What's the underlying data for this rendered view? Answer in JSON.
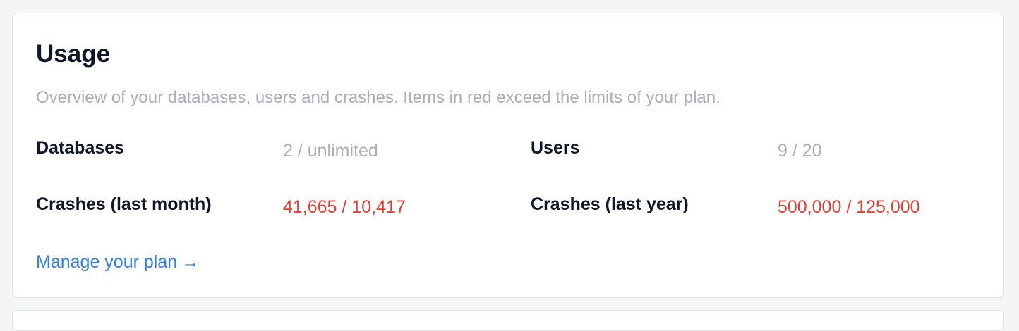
{
  "usage": {
    "title": "Usage",
    "description": "Overview of your databases, users and crashes. Items in red exceed the limits of your plan.",
    "stats": [
      {
        "label": "Databases",
        "value": "2 / unlimited",
        "exceeded": false
      },
      {
        "label": "Users",
        "value": "9 / 20",
        "exceeded": false
      },
      {
        "label": "Crashes (last month)",
        "value": "41,665 / 10,417",
        "exceeded": true
      },
      {
        "label": "Crashes (last year)",
        "value": "500,000 / 125,000",
        "exceeded": true
      }
    ],
    "manage_link": "Manage your plan",
    "manage_link_icon": "→"
  },
  "colors": {
    "title": "#0f172a",
    "muted": "#a9adb8",
    "exceeded": "#e53e33",
    "link": "#2f7fe6",
    "card_background": "#ffffff",
    "page_background": "#f4f5f7"
  },
  "icons": {
    "manage_link_arrow": "arrow-right-icon"
  }
}
